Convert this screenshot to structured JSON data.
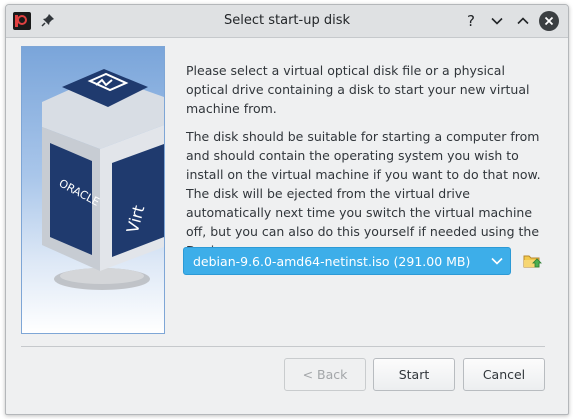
{
  "window": {
    "title": "Select start-up disk",
    "help_label": "?"
  },
  "wizard": {
    "paragraph1": "Please select a virtual optical disk file or a physical optical drive containing a disk to start your new virtual machine from.",
    "paragraph2": "The disk should be suitable for starting a computer from and should contain the operating system you wish to install on the virtual machine if you want to do that now. The disk will be ejected from the virtual drive automatically next time you switch the virtual machine off, but you can also do this yourself if needed using the Devices menu.",
    "disk_selector": {
      "selected": "debian-9.6.0-amd64-netinst.iso (291.00 MB)"
    },
    "logo": {
      "brand_text": "ORACLE",
      "product_text": "Virt"
    }
  },
  "buttons": {
    "back": "< Back",
    "start": "Start",
    "cancel": "Cancel"
  },
  "colors": {
    "accent": "#3daee9",
    "window_bg": "#eff0f1",
    "titlebar_bg": "#dfe1e3",
    "cube_dark": "#1f3a6e"
  }
}
